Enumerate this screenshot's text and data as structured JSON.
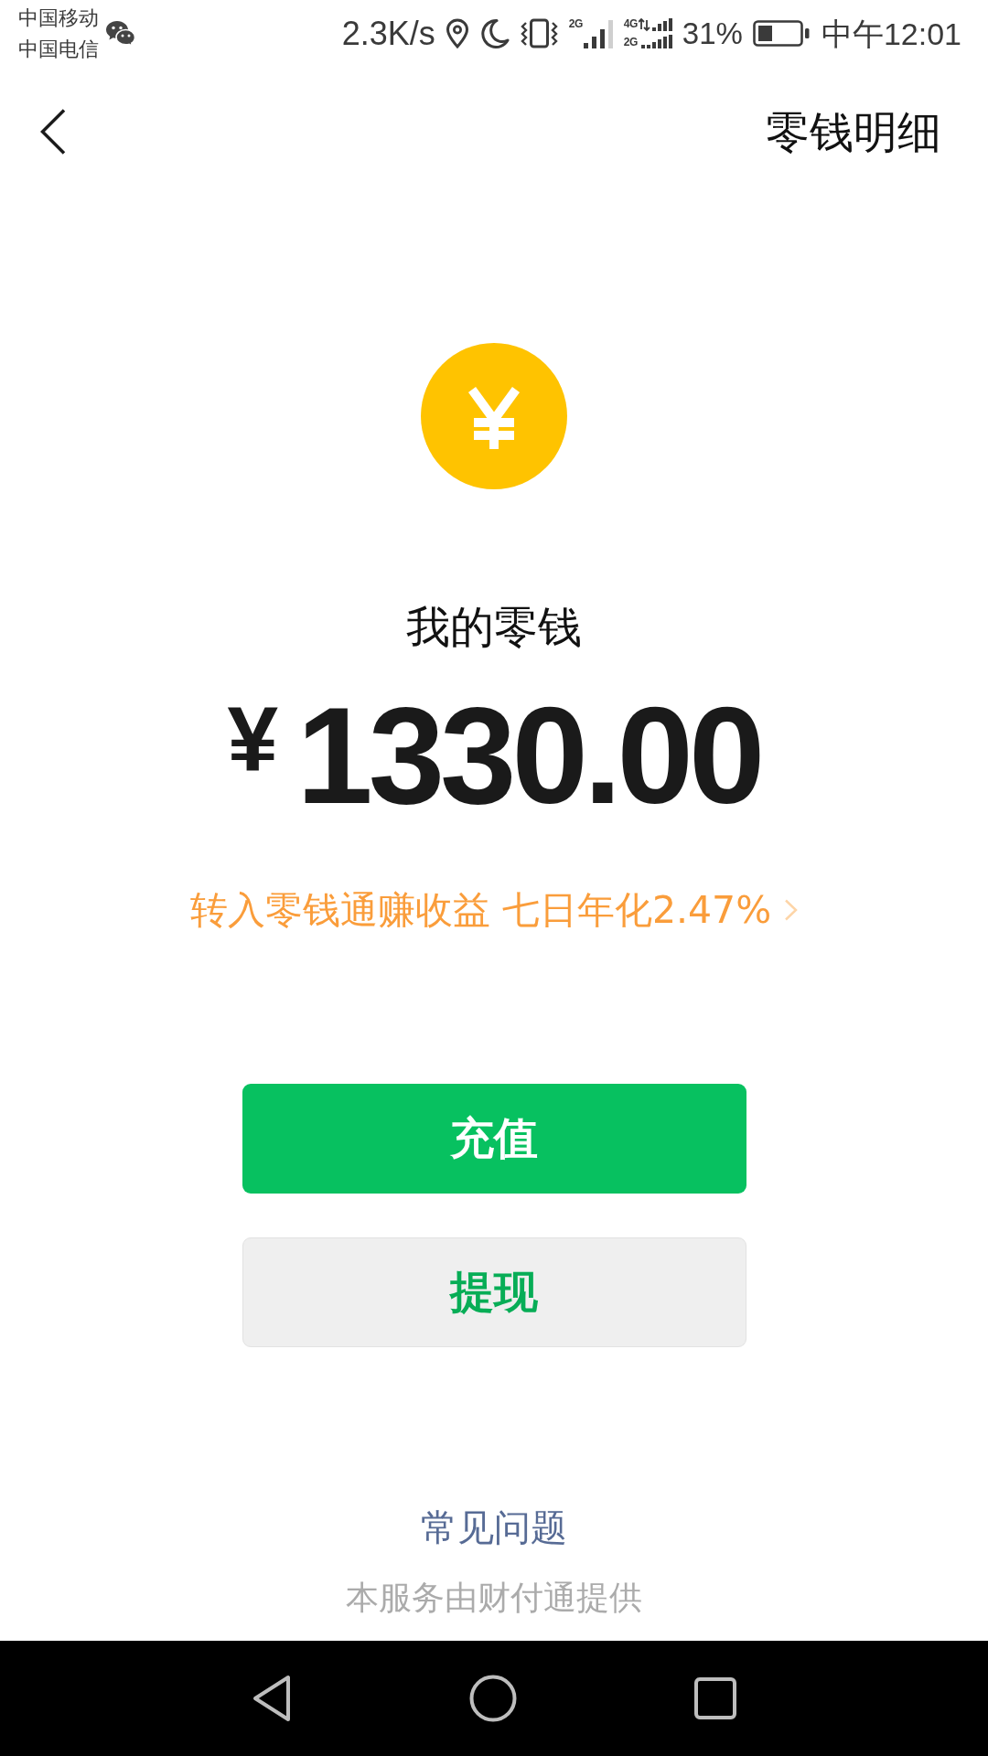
{
  "status_bar": {
    "carriers": [
      "中国移动",
      "中国电信"
    ],
    "net_speed": "2.3K/s",
    "signals": [
      {
        "kind": "single",
        "labels": [
          "2G"
        ]
      },
      {
        "kind": "dual",
        "labels": [
          "4G",
          "2G"
        ]
      }
    ],
    "battery_percent": "31%",
    "time": "中午12:01"
  },
  "header": {
    "title": "零钱明细"
  },
  "balance": {
    "label": "我的零钱",
    "currency": "¥",
    "amount": "1330.00",
    "promo": "转入零钱通赚收益 七日年化2.47%"
  },
  "buttons": [
    {
      "label": "充值",
      "kind": "primary"
    },
    {
      "label": "提现",
      "kind": "secondary"
    }
  ],
  "footer": {
    "link": "常见问题",
    "note": "本服务由财付通提供"
  }
}
